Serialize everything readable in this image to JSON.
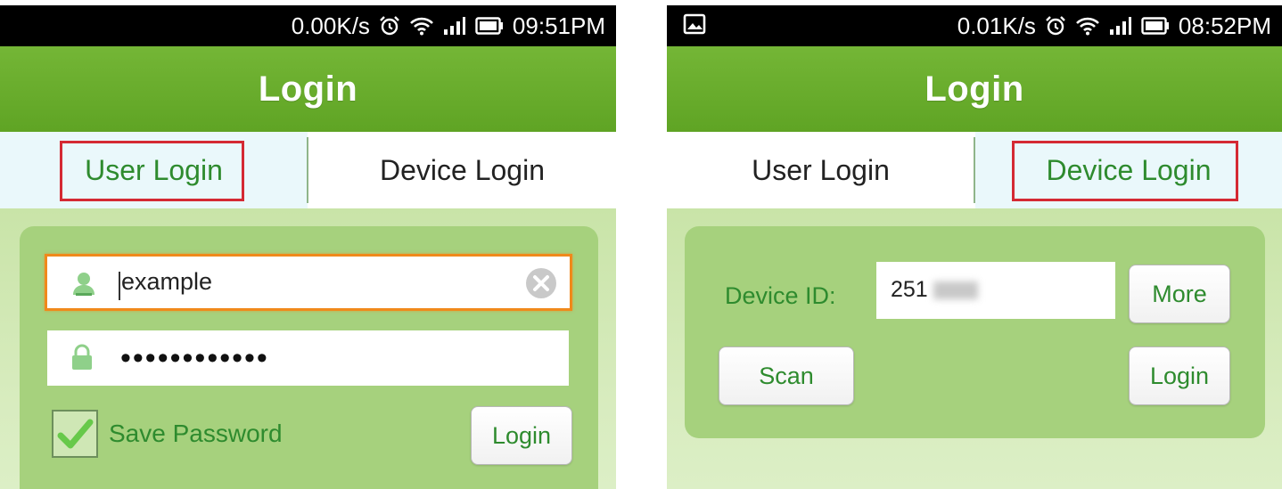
{
  "left_screen": {
    "status": {
      "speed": "0.00K/s",
      "time": "09:51PM",
      "icons": [
        "alarm-icon",
        "wifi-icon",
        "signal-icon",
        "battery-icon"
      ]
    },
    "title": "Login",
    "tabs": {
      "user_login": "User Login",
      "device_login": "Device Login",
      "active": "user_login"
    },
    "username": {
      "value": "example",
      "leading_icon": "user-icon",
      "trailing_icon": "clear-icon"
    },
    "password": {
      "masked_value": "••••••••••••",
      "leading_icon": "lock-icon"
    },
    "save_password": {
      "label": "Save Password",
      "checked": true
    },
    "login_button": "Login"
  },
  "right_screen": {
    "status": {
      "speed": "0.01K/s",
      "time": "08:52PM",
      "icons": [
        "picture-icon",
        "alarm-icon",
        "wifi-icon",
        "signal-icon",
        "battery-icon"
      ]
    },
    "title": "Login",
    "tabs": {
      "user_login": "User Login",
      "device_login": "Device Login",
      "active": "device_login"
    },
    "device_id": {
      "label": "Device ID:",
      "value": "251"
    },
    "more_button": "More",
    "scan_button": "Scan",
    "login_button": "Login"
  },
  "colors": {
    "title_bar": "#6bb02e",
    "accent_green": "#2e8b2e",
    "panel_green": "#a6d17d",
    "highlight_red": "#d42a33",
    "focus_orange": "#f0891b"
  }
}
